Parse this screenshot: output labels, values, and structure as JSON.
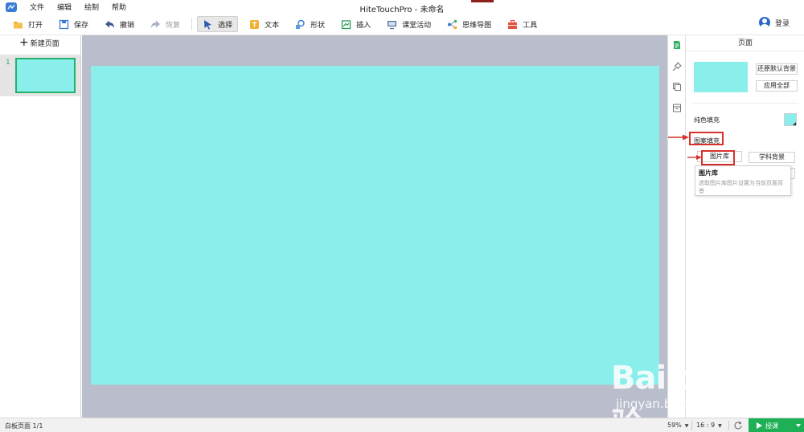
{
  "window": {
    "title": "HiteTouchPro - 未命名"
  },
  "menu": {
    "items": [
      "文件",
      "编辑",
      "绘制",
      "帮助"
    ]
  },
  "toolbar": {
    "open": "打开",
    "save": "保存",
    "undo": "撤销",
    "redo": "恢复",
    "select": "选择",
    "text": "文本",
    "shape": "形状",
    "insert": "插入",
    "classroom": "课堂活动",
    "mindmap": "思维导图",
    "tools": "工具",
    "login": "登录"
  },
  "left_panel": {
    "new_page": "新建页面",
    "pages": [
      {
        "number": "1"
      }
    ]
  },
  "right_panel": {
    "title": "页面",
    "restore_default_bg": "还原默认背景",
    "apply_all": "应用全部",
    "solid_fill": "纯色填充",
    "pattern_fill": "图案填充",
    "image_library": "图片库",
    "subject_bg": "学科背景",
    "tooltip": {
      "title": "图片库",
      "desc": "选取图片库图片设置为当前页面背景"
    }
  },
  "canvas": {
    "background_color": "#8aeeea"
  },
  "status": {
    "page_info": "白板页面 1/1",
    "zoom": "59%",
    "ratio": "16 : 9",
    "teach": "授课"
  },
  "colors": {
    "accent_green": "#1eb055",
    "highlight_red": "#d9312c",
    "canvas_bg": "#8aeeea",
    "workspace": "#b9bdcc"
  },
  "icons": [
    "app-logo-icon",
    "open-folder-icon",
    "save-icon",
    "undo-icon",
    "redo-icon",
    "cursor-icon",
    "text-icon",
    "shape-icon",
    "insert-icon",
    "classroom-icon",
    "mindmap-icon",
    "toolbox-icon",
    "user-icon",
    "page-panel-icon",
    "pin-icon",
    "layers-icon",
    "archive-icon",
    "refresh-icon",
    "play-icon"
  ],
  "watermark": {
    "brand": "Bai du 经验",
    "url": "jingyan.baidu.com"
  }
}
